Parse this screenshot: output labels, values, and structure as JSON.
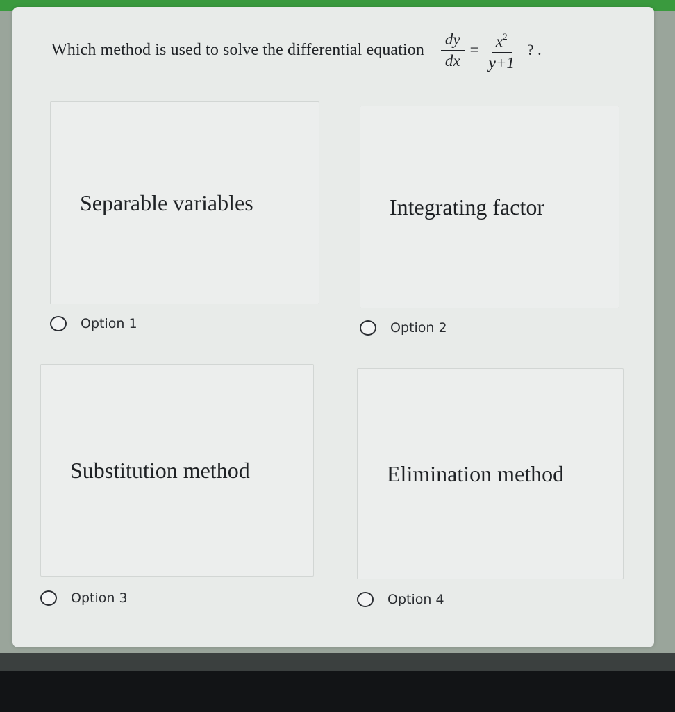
{
  "question": {
    "text": "Which method is used to solve the differential equation",
    "formula": {
      "lhs_numerator": "dy",
      "lhs_denominator": "dx",
      "equals": "=",
      "rhs_numerator": "x",
      "rhs_exponent": "2",
      "rhs_denominator": "y+1",
      "suffix": "? ."
    }
  },
  "options": [
    {
      "text": "Separable variables",
      "label": "Option 1"
    },
    {
      "text": "Integrating factor",
      "label": "Option 2"
    },
    {
      "text": "Substitution method",
      "label": "Option 3"
    },
    {
      "text": "Elimination method",
      "label": "Option 4"
    }
  ],
  "colors": {
    "top_bar": "#3a9a3e",
    "card_background": "#e8ebe9",
    "background": "#9aa59b"
  }
}
